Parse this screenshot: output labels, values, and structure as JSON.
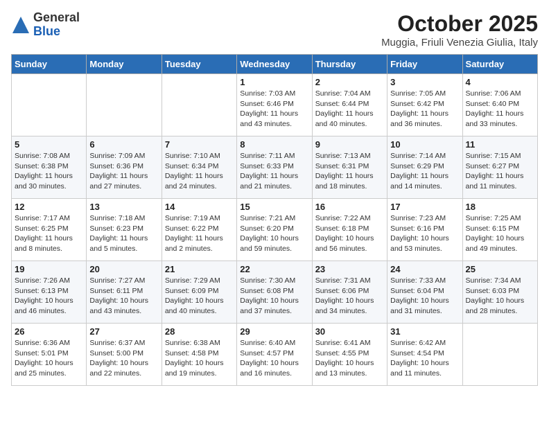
{
  "header": {
    "logo": {
      "general": "General",
      "blue": "Blue"
    },
    "title": "October 2025",
    "location": "Muggia, Friuli Venezia Giulia, Italy"
  },
  "weekdays": [
    "Sunday",
    "Monday",
    "Tuesday",
    "Wednesday",
    "Thursday",
    "Friday",
    "Saturday"
  ],
  "weeks": [
    [
      {
        "day": "",
        "info": ""
      },
      {
        "day": "",
        "info": ""
      },
      {
        "day": "",
        "info": ""
      },
      {
        "day": "1",
        "info": "Sunrise: 7:03 AM\nSunset: 6:46 PM\nDaylight: 11 hours\nand 43 minutes."
      },
      {
        "day": "2",
        "info": "Sunrise: 7:04 AM\nSunset: 6:44 PM\nDaylight: 11 hours\nand 40 minutes."
      },
      {
        "day": "3",
        "info": "Sunrise: 7:05 AM\nSunset: 6:42 PM\nDaylight: 11 hours\nand 36 minutes."
      },
      {
        "day": "4",
        "info": "Sunrise: 7:06 AM\nSunset: 6:40 PM\nDaylight: 11 hours\nand 33 minutes."
      }
    ],
    [
      {
        "day": "5",
        "info": "Sunrise: 7:08 AM\nSunset: 6:38 PM\nDaylight: 11 hours\nand 30 minutes."
      },
      {
        "day": "6",
        "info": "Sunrise: 7:09 AM\nSunset: 6:36 PM\nDaylight: 11 hours\nand 27 minutes."
      },
      {
        "day": "7",
        "info": "Sunrise: 7:10 AM\nSunset: 6:34 PM\nDaylight: 11 hours\nand 24 minutes."
      },
      {
        "day": "8",
        "info": "Sunrise: 7:11 AM\nSunset: 6:33 PM\nDaylight: 11 hours\nand 21 minutes."
      },
      {
        "day": "9",
        "info": "Sunrise: 7:13 AM\nSunset: 6:31 PM\nDaylight: 11 hours\nand 18 minutes."
      },
      {
        "day": "10",
        "info": "Sunrise: 7:14 AM\nSunset: 6:29 PM\nDaylight: 11 hours\nand 14 minutes."
      },
      {
        "day": "11",
        "info": "Sunrise: 7:15 AM\nSunset: 6:27 PM\nDaylight: 11 hours\nand 11 minutes."
      }
    ],
    [
      {
        "day": "12",
        "info": "Sunrise: 7:17 AM\nSunset: 6:25 PM\nDaylight: 11 hours\nand 8 minutes."
      },
      {
        "day": "13",
        "info": "Sunrise: 7:18 AM\nSunset: 6:23 PM\nDaylight: 11 hours\nand 5 minutes."
      },
      {
        "day": "14",
        "info": "Sunrise: 7:19 AM\nSunset: 6:22 PM\nDaylight: 11 hours\nand 2 minutes."
      },
      {
        "day": "15",
        "info": "Sunrise: 7:21 AM\nSunset: 6:20 PM\nDaylight: 10 hours\nand 59 minutes."
      },
      {
        "day": "16",
        "info": "Sunrise: 7:22 AM\nSunset: 6:18 PM\nDaylight: 10 hours\nand 56 minutes."
      },
      {
        "day": "17",
        "info": "Sunrise: 7:23 AM\nSunset: 6:16 PM\nDaylight: 10 hours\nand 53 minutes."
      },
      {
        "day": "18",
        "info": "Sunrise: 7:25 AM\nSunset: 6:15 PM\nDaylight: 10 hours\nand 49 minutes."
      }
    ],
    [
      {
        "day": "19",
        "info": "Sunrise: 7:26 AM\nSunset: 6:13 PM\nDaylight: 10 hours\nand 46 minutes."
      },
      {
        "day": "20",
        "info": "Sunrise: 7:27 AM\nSunset: 6:11 PM\nDaylight: 10 hours\nand 43 minutes."
      },
      {
        "day": "21",
        "info": "Sunrise: 7:29 AM\nSunset: 6:09 PM\nDaylight: 10 hours\nand 40 minutes."
      },
      {
        "day": "22",
        "info": "Sunrise: 7:30 AM\nSunset: 6:08 PM\nDaylight: 10 hours\nand 37 minutes."
      },
      {
        "day": "23",
        "info": "Sunrise: 7:31 AM\nSunset: 6:06 PM\nDaylight: 10 hours\nand 34 minutes."
      },
      {
        "day": "24",
        "info": "Sunrise: 7:33 AM\nSunset: 6:04 PM\nDaylight: 10 hours\nand 31 minutes."
      },
      {
        "day": "25",
        "info": "Sunrise: 7:34 AM\nSunset: 6:03 PM\nDaylight: 10 hours\nand 28 minutes."
      }
    ],
    [
      {
        "day": "26",
        "info": "Sunrise: 6:36 AM\nSunset: 5:01 PM\nDaylight: 10 hours\nand 25 minutes."
      },
      {
        "day": "27",
        "info": "Sunrise: 6:37 AM\nSunset: 5:00 PM\nDaylight: 10 hours\nand 22 minutes."
      },
      {
        "day": "28",
        "info": "Sunrise: 6:38 AM\nSunset: 4:58 PM\nDaylight: 10 hours\nand 19 minutes."
      },
      {
        "day": "29",
        "info": "Sunrise: 6:40 AM\nSunset: 4:57 PM\nDaylight: 10 hours\nand 16 minutes."
      },
      {
        "day": "30",
        "info": "Sunrise: 6:41 AM\nSunset: 4:55 PM\nDaylight: 10 hours\nand 13 minutes."
      },
      {
        "day": "31",
        "info": "Sunrise: 6:42 AM\nSunset: 4:54 PM\nDaylight: 10 hours\nand 11 minutes."
      },
      {
        "day": "",
        "info": ""
      }
    ]
  ]
}
